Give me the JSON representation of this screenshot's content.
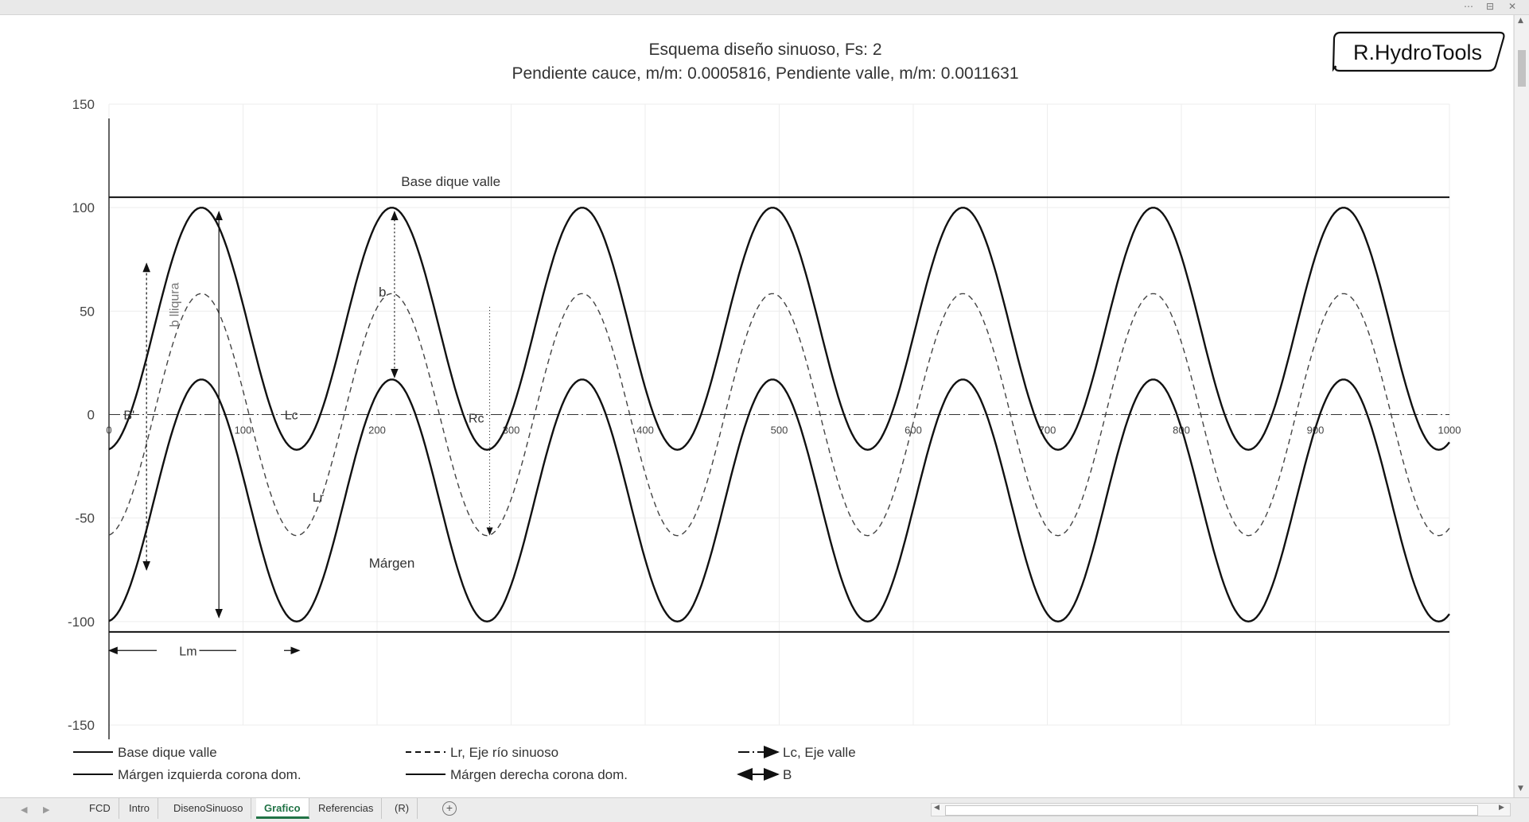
{
  "window": {
    "controls": [
      "⋯",
      "⊟",
      "✕"
    ]
  },
  "chart_data": {
    "type": "line",
    "title": "Esquema diseño sinuoso, Fs: 2",
    "subtitle": "Pendiente cauce, m/m: 0.0005816, Pendiente valle, m/m: 0.0011631",
    "xlim": [
      0,
      1000
    ],
    "ylim": [
      -150,
      150
    ],
    "x_ticks": [
      "0",
      "100",
      "200",
      "300",
      "400",
      "500",
      "600",
      "700",
      "800",
      "900",
      "1000"
    ],
    "y_ticks": [
      "150",
      "100",
      "50",
      "0",
      "-50",
      "-100",
      "-150"
    ],
    "grid": true,
    "legend_position": "bottom",
    "wavelength": 142,
    "series": [
      {
        "name": "Base dique valle",
        "style": "solid",
        "values_upper": 105,
        "values_lower": -105
      },
      {
        "name": "Lr, Eje río sinuoso",
        "style": "dashed",
        "center": 0,
        "amplitude": 58.5,
        "peak_x": 69
      },
      {
        "name": "Lc, Eje valle",
        "style": "dashdot",
        "y": 0
      },
      {
        "name": "Márgen izquierda corona dom.",
        "style": "solid",
        "center": 41.5,
        "amplitude": 58.5,
        "peak_x": 69
      },
      {
        "name": "Márgen derecha corona dom.",
        "style": "solid",
        "center": -41.5,
        "amplitude": 58.5,
        "peak_x": 69
      },
      {
        "name": "B",
        "style": "arrow"
      }
    ],
    "annotations": {
      "base_dique": "Base dique valle",
      "b_prime": "B'",
      "lc": "Lc",
      "rc": "Rc",
      "b": "b",
      "b_lliqura": "b lliqura",
      "lr": "Lr",
      "margen": "Márgen",
      "lm": "Lm"
    },
    "legend": [
      "Base dique valle",
      "Lr, Eje río sinuoso",
      "Lc, Eje valle",
      "Márgen izquierda corona dom.",
      "Márgen derecha corona dom.",
      "B"
    ]
  },
  "logo": {
    "text": "R.HydroTools"
  },
  "sheet_tabs": [
    {
      "label": "FCD",
      "active": false
    },
    {
      "label": "Intro",
      "active": false
    },
    {
      "label": "DisenoSinuoso",
      "active": false
    },
    {
      "label": "Grafico",
      "active": true
    },
    {
      "label": "Referencias",
      "active": false
    },
    {
      "label": "(R)",
      "active": false
    }
  ],
  "tab_nav": {
    "prev": "◀",
    "next": "▶",
    "add": "+"
  },
  "scroll": {
    "up": "▲",
    "down": "▼",
    "left": "◀",
    "right": "▶"
  }
}
